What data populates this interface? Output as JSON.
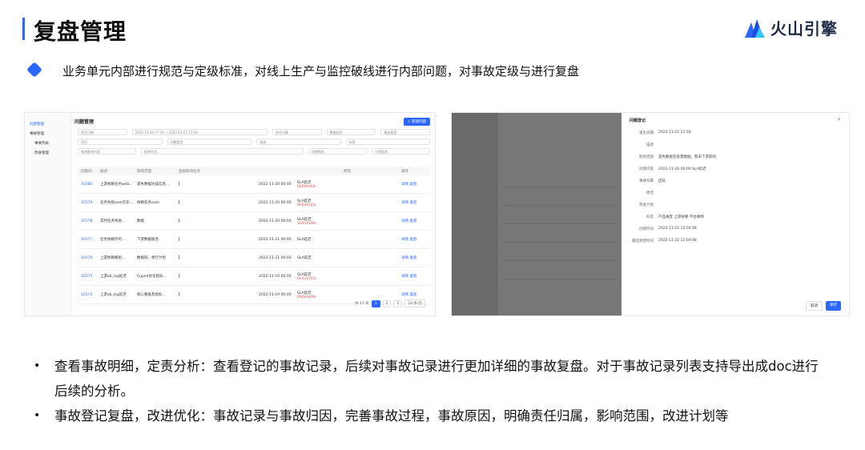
{
  "header": {
    "title": "复盘管理",
    "logo_text": "火山引擎"
  },
  "lead": "业务单元内部进行规范与定级标准，对线上生产与监控破线进行内部问题，对事故定级与进行复盘",
  "left_shot": {
    "sidebar": [
      "问题管理",
      "事故管理",
      "事故列表",
      "改进管理"
    ],
    "page_title": "问题管理",
    "new_button": "+ 新建问题",
    "filters_row1": [
      "发生日期",
      "2022-11-04 17:16  →  2022-11-22 17:16",
      "责任归属",
      "数据团队",
      "根因类型"
    ],
    "filters_row2": [
      "项目",
      "问题类型",
      "描述",
      "标签"
    ],
    "filters_row3": [
      "查询影响内容",
      "影响任务",
      "快捷筛选",
      "与我相关"
    ],
    "columns": [
      "问题ID",
      "描述",
      "影响范围",
      "直接影响任务",
      "",
      "",
      "原因",
      "操作"
    ],
    "rows": [
      {
        "id": "10180",
        "desc": "上游依赖任务web...",
        "scope": "遗失数据达成信息...",
        "time": "2022-11-20 00:00",
        "sla": "SLA延迟",
        "late": "0h00m43s"
      },
      {
        "id": "10179",
        "desc": "任务失败oom元乐...",
        "scope": "依赖任务oom",
        "time": "2022-11-20 00:00",
        "sla": "SLA延迟",
        "late": "0h03m13s"
      },
      {
        "id": "10178",
        "desc": "实时任务失败...",
        "scope": "数据",
        "time": "2022-11-20 00:00",
        "sla": "SLA延迟",
        "late": "1h21m04s"
      },
      {
        "id": "10177",
        "desc": "任务依赖存的...",
        "scope": "下游数据服务",
        "time": "2022-11-21 00:00",
        "sla": "SLA延迟",
        "late": ""
      },
      {
        "id": "10176",
        "desc": "上游依赖模组...",
        "scope": "数据链、更行计划",
        "time": "2022-11-21 00:00",
        "sla": "SLA延迟",
        "late": ""
      },
      {
        "id": "10175",
        "desc": "上游ab_log延迟",
        "scope": "Cuped优化指标...",
        "time": "2022-11-19 00:00",
        "sla": "SLA延迟",
        "late": "0h11m11s"
      },
      {
        "id": "10174",
        "desc": "上游ab_log延迟",
        "scope": "核心看板及指标...",
        "time": "2022-11-19 00:00",
        "sla": "SLA延迟",
        "late": "0h04m09s"
      }
    ],
    "row_actions": [
      "详情",
      "复盘"
    ],
    "pager": {
      "total": "共 47 条",
      "pages": [
        "1",
        "2",
        "3"
      ],
      "size": "10 条/页"
    }
  },
  "right_shot": {
    "drawer_title": "问题登记",
    "fields": [
      {
        "label": "发生日期",
        "value": "2022-11-22 11:59"
      },
      {
        "label": "描述",
        "value": ""
      },
      {
        "label": "影响范围",
        "value": "遗失数据及容量数据，暂未下游影响"
      },
      {
        "label": "问题内容",
        "value": "2022-11-20 00:00   SLA延迟"
      },
      {
        "label": "事故归属",
        "value": "团队"
      },
      {
        "label": "原因",
        "value": ""
      },
      {
        "label": "改进计划",
        "value": ""
      },
      {
        "label": "标签",
        "value": "产品维度  上游依赖  平台故障"
      },
      {
        "label": "创建时间",
        "value": "2022-11-22 12:04:08"
      },
      {
        "label": "最后更新时间",
        "value": "2022-11-22 12:04:08"
      }
    ],
    "cancel": "取消",
    "save": "保存"
  },
  "bullets": [
    "查看事故明细，定责分析：查看登记的事故记录，后续对事故记录进行更加详细的事故复盘。对于事故记录列表支持导出成doc进行后续的分析。",
    "事故登记复盘，改进优化：事故记录与事故归因，完善事故过程，事故原因，明确责任归属，影响范围，改进计划等"
  ],
  "colors": {
    "accent": "#2b66ff",
    "text": "#111111",
    "error": "#e5484d"
  }
}
